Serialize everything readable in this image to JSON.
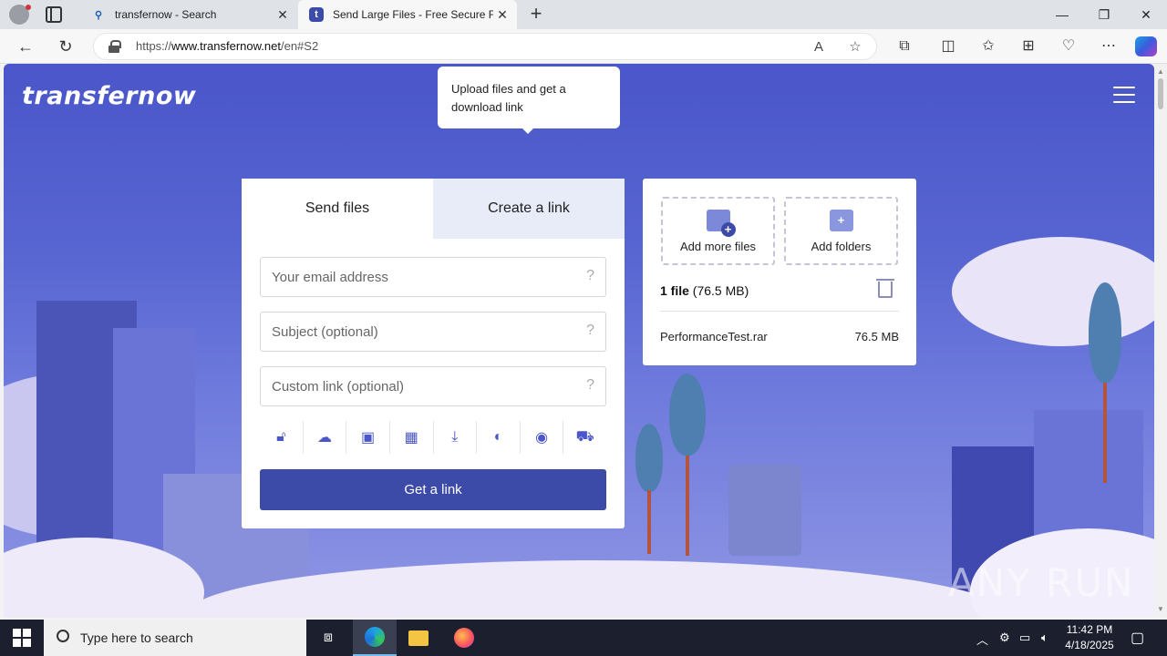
{
  "browser": {
    "tabs": [
      {
        "title": "transfernow - Search",
        "favicon": "search-icon"
      },
      {
        "title": "Send Large Files - Free Secure File",
        "favicon": "transfernow-logo-icon"
      }
    ],
    "url_prefix": "https://",
    "url_host": "www.transfernow.net",
    "url_path": "/en#S2"
  },
  "page": {
    "logo": "transfernow",
    "tooltip": "Upload files and get a download link",
    "tabs": {
      "send": "Send files",
      "link": "Create a link"
    },
    "fields": {
      "email_placeholder": "Your email address",
      "subject_placeholder": "Subject (optional)",
      "custom_link_placeholder": "Custom link (optional)",
      "help_glyph": "?"
    },
    "options": [
      "lock-icon",
      "cloud-sync-icon",
      "image-icon",
      "calendar-icon",
      "download-icon",
      "globe-icon",
      "eye-icon",
      "cart-icon"
    ],
    "get_link_label": "Get a link",
    "files_panel": {
      "add_files": "Add more files",
      "add_folders": "Add folders",
      "summary_count": "1 file",
      "summary_size": "(76.5 MB)",
      "file_name": "PerformanceTest.rar",
      "file_size": "76.5 MB"
    },
    "watermark": "ANY RUN"
  },
  "taskbar": {
    "search_placeholder": "Type here to search",
    "time": "11:42 PM",
    "date": "4/18/2025"
  },
  "colors": {
    "accent": "#3c4aa8",
    "page_bg": "#4a56c9"
  }
}
